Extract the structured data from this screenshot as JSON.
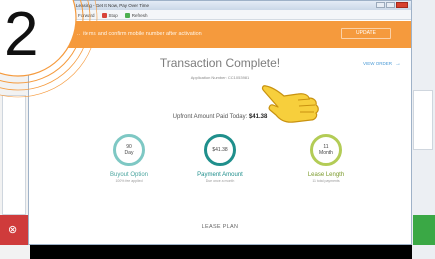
{
  "window": {
    "title": "... Leasing - Get It Now, Pay Over Time",
    "toolbar": {
      "forward_label": "Forward",
      "stop_label": "Stop",
      "refresh_label": "Refresh"
    }
  },
  "banner": {
    "text": "... items and confirm mobile number after activation",
    "button_label": "UPDATE"
  },
  "main": {
    "title": "Transaction Complete!",
    "application_number_label": "Application Number",
    "application_number": "CC1053981",
    "view_order_label": "VIEW ORDER",
    "upfront_label": "Upfront Amount Paid Today:",
    "upfront_amount": "$41.38",
    "stats": [
      {
        "value_line1": "90",
        "value_line2": "Day",
        "label": "Buyout Option",
        "sub": "100% fee applied",
        "ring_color": "#7ec8c4",
        "label_color": "#4aa59f"
      },
      {
        "value_line1": "$41.38",
        "value_line2": "",
        "label": "Payment Amount",
        "sub": "Due once a month",
        "ring_color": "#1f8f8c",
        "label_color": "#1f8f8c"
      },
      {
        "value_line1": "11",
        "value_line2": "Month",
        "label": "Lease Length",
        "sub": "11 total payments",
        "ring_color": "#b3cc56",
        "label_color": "#7a9a2a"
      }
    ],
    "section_label": "LEASE PLAN"
  },
  "overlay": {
    "step_number": "2",
    "icons": [
      "pointing-hand-icon"
    ],
    "accent_color": "#f59a3d"
  }
}
